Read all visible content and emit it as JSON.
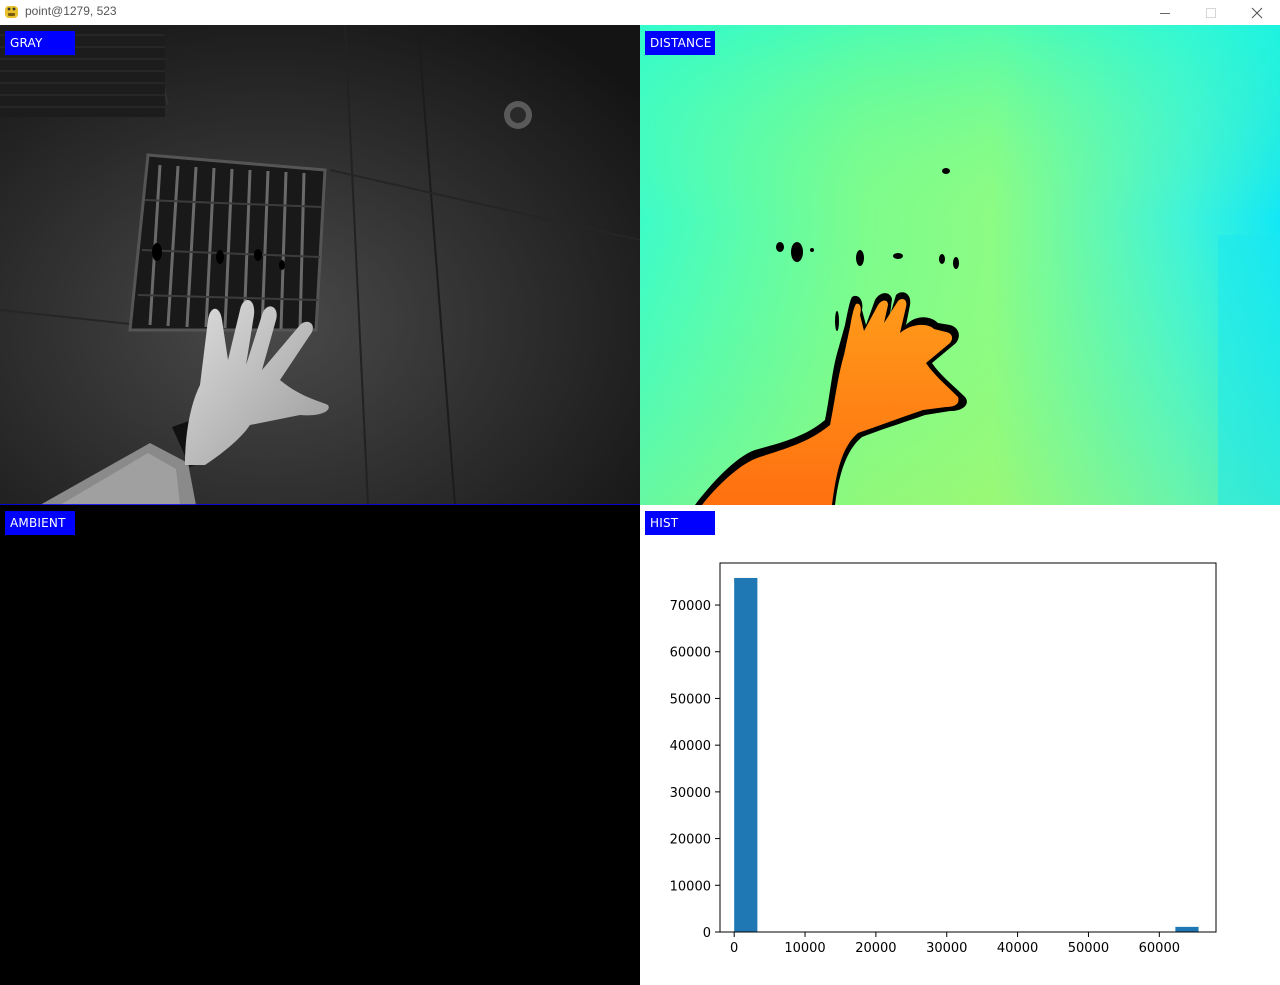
{
  "window": {
    "title": "point@1279, 523",
    "controls": {
      "minimize": "minimize-icon",
      "maximize": "maximize-icon",
      "close": "close-icon"
    }
  },
  "panels": {
    "gray": {
      "label": "GRAY"
    },
    "distance": {
      "label": "DISTANCE"
    },
    "ambient": {
      "label": "AMBIENT"
    },
    "hist": {
      "label": "HIST"
    }
  },
  "colors": {
    "label_bg": "#0000ff",
    "label_text": "#ffffff",
    "bar": "#1f77b4",
    "distance_background": "#66ff99",
    "distance_hand": "#ff8c1a",
    "ambient_background": "#000000"
  },
  "chart_data": {
    "type": "bar",
    "title": "",
    "xlabel": "",
    "ylabel": "",
    "xlim": [
      -2000,
      68000
    ],
    "ylim": [
      0,
      79000
    ],
    "xticks": [
      0,
      10000,
      20000,
      30000,
      40000,
      50000,
      60000
    ],
    "yticks": [
      0,
      10000,
      20000,
      30000,
      40000,
      50000,
      60000,
      70000
    ],
    "bin_width": 3276,
    "bins": [
      {
        "x_start": 0,
        "value": 75800
      },
      {
        "x_start": 62264,
        "value": 1100
      }
    ],
    "grid": false,
    "legend": "none"
  }
}
